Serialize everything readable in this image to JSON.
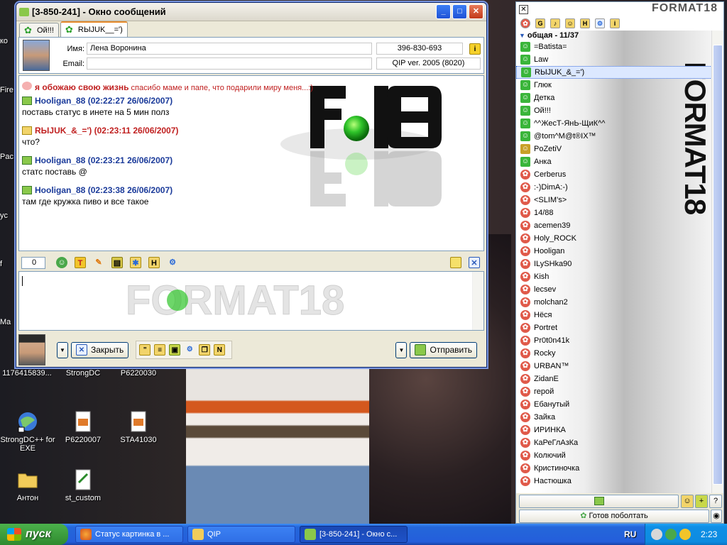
{
  "desktop": {
    "edge_labels": [
      "ко",
      "Fire",
      "Pac",
      "yc",
      "f",
      "Ma"
    ],
    "icons": [
      {
        "label": "1176415839..."
      },
      {
        "label": "StrongDC"
      },
      {
        "label": "P6220030"
      },
      {
        "label": "StrongDC++ for EXE"
      },
      {
        "label": "P6220007"
      },
      {
        "label": "STA41030"
      },
      {
        "label": "Антон"
      },
      {
        "label": "st_custom"
      }
    ]
  },
  "message_window": {
    "title": "[3-850-241] - Окно сообщений",
    "tabs": [
      {
        "label": "Ой!!!"
      },
      {
        "label": "RЫJUK__=')"
      }
    ],
    "info": {
      "name_label": "Имя:",
      "name_value": "Лена  Воронина",
      "uin": "396-830-693",
      "email_label": "Email:",
      "email_value": "",
      "client": "QIP ver. 2005 (8020)"
    },
    "status_message": {
      "bold": "я обожаю свою жизнь",
      "rest": " спасибо маме и папе, что подарили миру меня...:)"
    },
    "messages": [
      {
        "sender": "Hooligan_88",
        "time": "(02:22:27 26/06/2007)",
        "text": "поставь статус в инете на 5 мин полз",
        "color": "#1a3a9a"
      },
      {
        "sender": "RЫJUK_&_=')",
        "time": "(02:23:11 26/06/2007)",
        "text": "что?",
        "color": "#c02020"
      },
      {
        "sender": "Hooligan_88",
        "time": "(02:23:21 26/06/2007)",
        "text": "статс поставь @",
        "color": "#1a3a9a"
      },
      {
        "sender": "Hooligan_88",
        "time": "(02:23:38 26/06/2007)",
        "text": "там где кружка пиво и все такое",
        "color": "#1a3a9a"
      }
    ],
    "char_count": "0",
    "logo_text": "FORMAT18",
    "close_label": "Закрыть",
    "send_label": "Отправить"
  },
  "contact_list": {
    "brand": "FORMAT18",
    "watermark": "FORMAT18",
    "group": "общая - 11/37",
    "contacts": [
      {
        "name": "=Batista=",
        "status": "online"
      },
      {
        "name": "Law",
        "status": "online"
      },
      {
        "name": "RЫJUK_&_=')",
        "status": "online",
        "selected": true
      },
      {
        "name": "Глюк",
        "status": "online"
      },
      {
        "name": "Детка",
        "status": "online"
      },
      {
        "name": "Ой!!!",
        "status": "online"
      },
      {
        "name": "^^ЖесТ-ЯнЬ-ЩиК^^",
        "status": "online"
      },
      {
        "name": "@tom^M@t®IX™",
        "status": "online"
      },
      {
        "name": "PoZetiV",
        "status": "na"
      },
      {
        "name": "Анка",
        "status": "online"
      },
      {
        "name": "Cerberus",
        "status": "offline"
      },
      {
        "name": ":-)DimA:-)",
        "status": "offline"
      },
      {
        "name": "<SLIM's>",
        "status": "offline"
      },
      {
        "name": "14/88",
        "status": "offline"
      },
      {
        "name": "acemen39",
        "status": "offline"
      },
      {
        "name": "Holy_ROCK",
        "status": "offline"
      },
      {
        "name": "Hooligan",
        "status": "offline"
      },
      {
        "name": "ILySHka90",
        "status": "offline"
      },
      {
        "name": "Kish",
        "status": "offline"
      },
      {
        "name": "lecsev",
        "status": "offline"
      },
      {
        "name": "molchan2",
        "status": "offline"
      },
      {
        "name": "Нёся",
        "status": "offline"
      },
      {
        "name": "Portret",
        "status": "offline"
      },
      {
        "name": "Pr0t0n41k",
        "status": "offline"
      },
      {
        "name": "Rocky",
        "status": "offline"
      },
      {
        "name": "URBAN™",
        "status": "offline"
      },
      {
        "name": "ZidanE",
        "status": "offline"
      },
      {
        "name": "герой",
        "status": "offline"
      },
      {
        "name": "Ебанутый",
        "status": "offline"
      },
      {
        "name": "Зайка",
        "status": "offline"
      },
      {
        "name": "ИРИНКА",
        "status": "offline"
      },
      {
        "name": "КаРеГлАзКа",
        "status": "offline"
      },
      {
        "name": "Колючий",
        "status": "offline"
      },
      {
        "name": "Кристиночка",
        "status": "offline"
      },
      {
        "name": "Настюшка",
        "status": "offline"
      }
    ],
    "status_label": "Готов поболтать"
  },
  "taskbar": {
    "start_label": "пуск",
    "tasks": [
      {
        "label": "Статус картинка в ..."
      },
      {
        "label": "QIP"
      },
      {
        "label": "[3-850-241] - Окно с..."
      }
    ],
    "lang": "RU",
    "clock": "2:23"
  }
}
